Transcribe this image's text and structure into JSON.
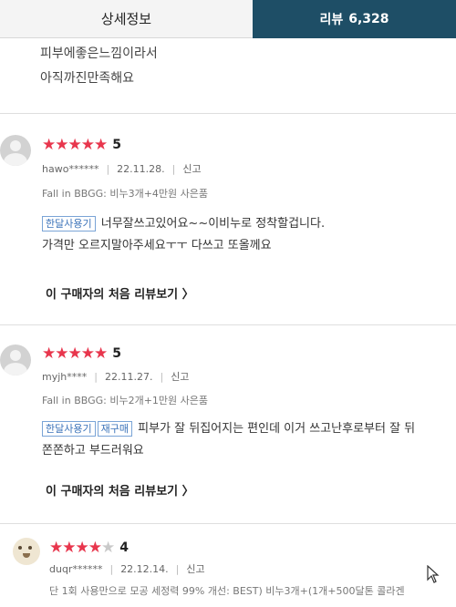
{
  "tabs": {
    "info": "상세정보",
    "review_label": "리뷰",
    "review_count": "6,328"
  },
  "previous_review_tail": {
    "line1": "피부에좋은느낌이라서",
    "line2": "아직까진만족해요"
  },
  "reviews": [
    {
      "stars": "★★★★★",
      "stars_off": "",
      "score": "5",
      "user": "hawo******",
      "date": "22.11.28.",
      "report": "신고",
      "option": "Fall in BBGG: 비누3개+4만원 사은품",
      "tags": [
        "한달사용기"
      ],
      "line1": "너무잘쓰고있어요~~이비누로 정착할겁니다.",
      "line2": "가격만 오르지말아주세요ㅜㅜ 다쓰고 또올께요",
      "first_review_link": "이 구매자의 처음 리뷰보기 〉"
    },
    {
      "stars": "★★★★★",
      "stars_off": "",
      "score": "5",
      "user": "myjh****",
      "date": "22.11.27.",
      "report": "신고",
      "option": "Fall in BBGG: 비누2개+1만원 사은품",
      "tags": [
        "한달사용기",
        "재구매"
      ],
      "line1": "피부가 잘 뒤집어지는 편인데 이거 쓰고난후로부터 잘 뒤",
      "line2": "쫀쫀하고 부드러워요",
      "first_review_link": "이 구매자의 처음 리뷰보기 〉"
    },
    {
      "stars": "★★★★",
      "stars_off": "★",
      "score": "4",
      "user": "duqr******",
      "date": "22.12.14.",
      "report": "신고",
      "option": "단 1회 사용만으로 모공 세정력 99% 개선: BEST) 비누3개+(1개+500달톤 콜라겐"
    }
  ]
}
